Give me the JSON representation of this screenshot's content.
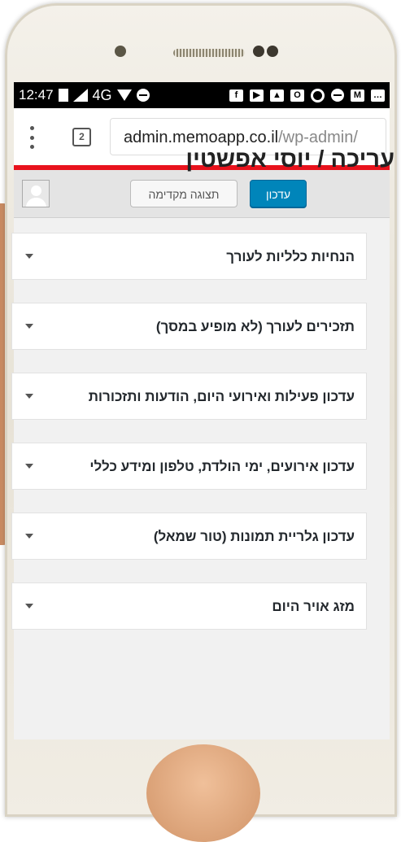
{
  "statusbar": {
    "time": "12:47",
    "network": "4G"
  },
  "browser": {
    "tab_count": "2",
    "url_host": "admin.memoapp.co.il",
    "url_path": "/wp-admin/"
  },
  "adminbar": {
    "update_label": "עדכון",
    "preview_label": "תצוגה מקדימה"
  },
  "page": {
    "title": "עריכה / יוסי אפשטין"
  },
  "panels": [
    {
      "title": "הנחיות כלליות לעורך"
    },
    {
      "title": "תזכירים לעורך (לא מופיע במסך)"
    },
    {
      "title": "עדכון פעילות ואירועי היום, הודעות ותזכורות"
    },
    {
      "title": "עדכון אירועים, ימי הולדת, טלפון ומידע כללי"
    },
    {
      "title": "עדכון גלריית תמונות (טור שמאל)"
    },
    {
      "title": "מזג אויר היום"
    }
  ],
  "colors": {
    "accent": "#0085ba",
    "browser_progress": "#e8121c",
    "admin_bar": "#e4e4e4"
  }
}
